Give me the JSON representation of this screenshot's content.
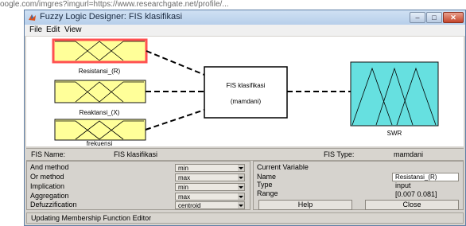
{
  "background_url_text": "oogle.com/imgres?imgurl=https://www.researchgate.net/profile/...",
  "window": {
    "title": "Fuzzy Logic Designer: FIS klasifikasi",
    "buttons": [
      "minimize-button",
      "maximize-button",
      "close-button"
    ]
  },
  "menu": {
    "file": "File",
    "edit": "Edit",
    "view": "View"
  },
  "diagram": {
    "inputs": [
      {
        "label": "Resistansi_(R)",
        "selected": true
      },
      {
        "label": "Reaktansi_(X)",
        "selected": false
      },
      {
        "label": "frekuensi",
        "selected": false
      }
    ],
    "fis_box": {
      "line1": "FIS klasifikasi",
      "line2": "(mamdani)"
    },
    "output": {
      "label": "SWR"
    },
    "colors": {
      "input_fill": "#ffff99",
      "selected_border": "#ff5050",
      "output_fill": "#66e0e0"
    }
  },
  "info": {
    "fis_name_label": "FIS Name:",
    "fis_name_value": "FIS klasifikasi",
    "fis_type_label": "FIS Type:",
    "fis_type_value": "mamdani"
  },
  "methods": [
    {
      "label": "And method",
      "value": "min"
    },
    {
      "label": "Or method",
      "value": "max"
    },
    {
      "label": "Implication",
      "value": "min"
    },
    {
      "label": "Aggregation",
      "value": "max"
    },
    {
      "label": "Defuzzification",
      "value": "centroid"
    }
  ],
  "current_variable": {
    "header": "Current Variable",
    "name_label": "Name",
    "name_value": "Resistansi_(R)",
    "type_label": "Type",
    "type_value": "input",
    "range_label": "Range",
    "range_value": "[0.007 0.081]"
  },
  "buttons": {
    "help": "Help",
    "close": "Close"
  },
  "status": "Updating Membership Function Editor"
}
